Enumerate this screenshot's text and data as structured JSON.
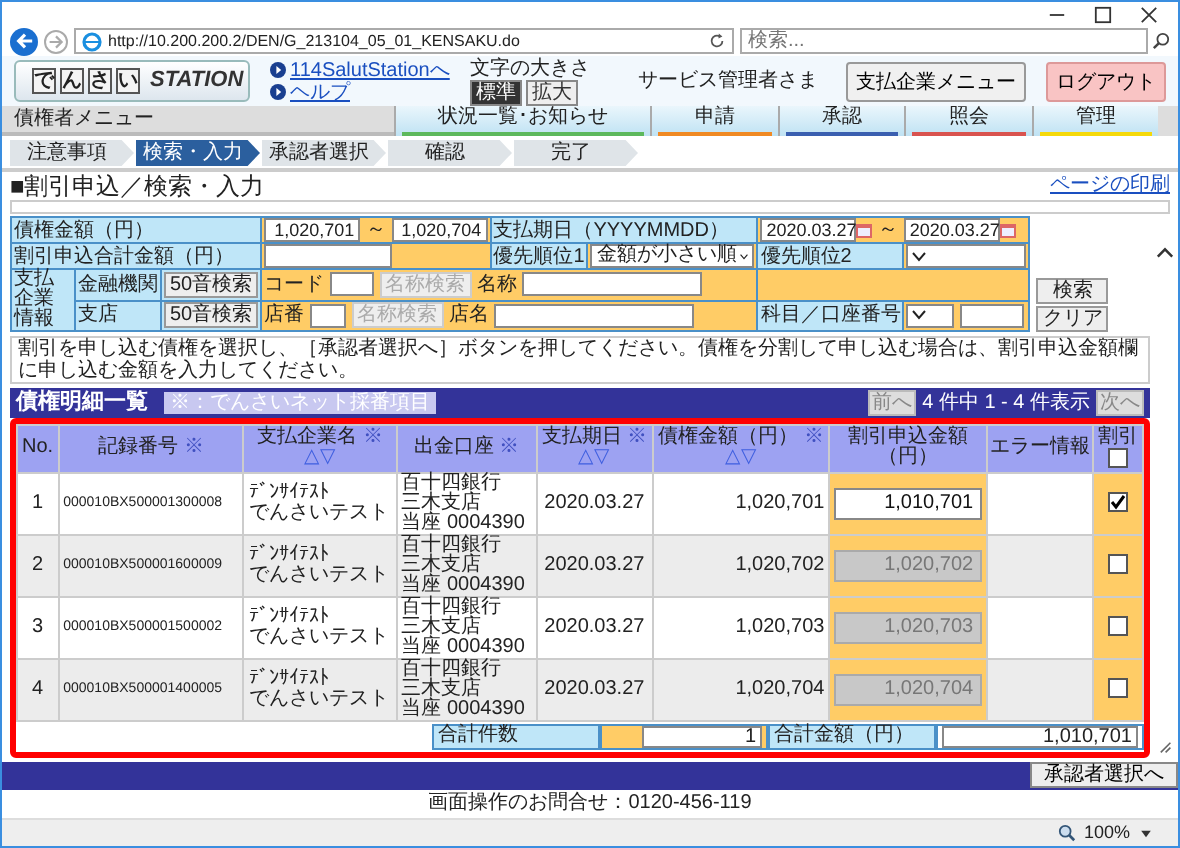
{
  "browser": {
    "url": "http://10.200.200.2/DEN/G_213104_05_01_KENSAKU.do",
    "search_placeholder": "検索..."
  },
  "header": {
    "logo": {
      "blocks": [
        "で",
        "ん",
        "さ",
        "い"
      ],
      "text": "STATION"
    },
    "links": [
      "114SalutStationへ",
      "ヘルプ"
    ],
    "font_size": {
      "label": "文字の大きさ",
      "options": [
        {
          "label": "標準",
          "selected": true
        },
        {
          "label": "拡大",
          "selected": false
        }
      ]
    },
    "user": "サービス管理者さま",
    "buttons": [
      {
        "label": "支払企業メニュー",
        "kind": "normal"
      },
      {
        "label": "ログアウト",
        "kind": "logout"
      }
    ]
  },
  "menu": {
    "title": "債権者メニュー",
    "items": [
      {
        "label": "状況一覧･お知らせ",
        "color": "#5cb85c"
      },
      {
        "label": "申請",
        "color": "#f08a24"
      },
      {
        "label": "承認",
        "color": "#3a5fb0"
      },
      {
        "label": "照会",
        "color": "#d9534f"
      },
      {
        "label": "管理",
        "color": "#f5d90a"
      }
    ]
  },
  "steps": [
    {
      "label": "注意事項",
      "selected": false
    },
    {
      "label": "検索・入力",
      "selected": true
    },
    {
      "label": "承認者選択",
      "selected": false
    },
    {
      "label": "確認",
      "selected": false
    },
    {
      "label": "完了",
      "selected": false
    }
  ],
  "page": {
    "title": "■割引申込／検索・入力",
    "print_link": "ページの印刷"
  },
  "search": {
    "amount": {
      "label": "債権金額（円）",
      "from": "1,020,701",
      "sep": "～",
      "to": "1,020,704"
    },
    "due": {
      "label": "支払期日（YYYYMMDD）",
      "from": "2020.03.27",
      "sep": "～",
      "to": "2020.03.27"
    },
    "total_label": "割引申込合計金額（円）",
    "priority1": {
      "label": "優先順位1",
      "value": "金額が小さい順"
    },
    "priority2": {
      "label": "優先順位2"
    },
    "company_label": "支払企業情報",
    "bank": {
      "label": "金融機関",
      "kana_button": "50音検索",
      "code_label": "コード",
      "name_search": {
        "label": "名称検索",
        "disabled": true
      },
      "name_label": "名称"
    },
    "branch": {
      "label": "支店",
      "kana_button": "50音検索",
      "code_label": "店番",
      "name_search": {
        "label": "名称検索",
        "disabled": true
      },
      "name_label": "店名"
    },
    "account_label": "科目／口座番号",
    "buttons": [
      "検索",
      "クリア"
    ]
  },
  "instruction": "割引を申し込む債権を選択し、［承認者選択へ］ボタンを押してください。債権を分割して申し込む場合は、割引申込金額欄に申し込む金額を入力してください。",
  "list": {
    "title": "債権明細一覧",
    "note": "※：でんさいネット採番項目",
    "pager": {
      "prev": "前へ",
      "info": "4 件中 1 - 4 件表示",
      "next": "次へ"
    },
    "columns": [
      {
        "label": "No."
      },
      {
        "label": "記録番号",
        "note": "※"
      },
      {
        "label": "支払企業名",
        "note": "※",
        "sort": "△▽"
      },
      {
        "label": "出金口座",
        "note": "※"
      },
      {
        "label": "支払期日",
        "note": "※",
        "sort": "△▽"
      },
      {
        "label": "債権金額（円）",
        "note": "※",
        "sort": "△▽"
      },
      {
        "label": "割引申込金額（円）"
      },
      {
        "label": "エラー情報"
      },
      {
        "label": "割引",
        "checked": false
      }
    ],
    "rows": [
      {
        "no": "1",
        "record": "000010BX500001300008",
        "company_kana": "ﾃﾞﾝｻｲﾃｽﾄ",
        "company": "でんさいテスト",
        "bank": "百十四銀行",
        "branch": "三木支店",
        "account": "当座 0004390",
        "due": "2020.03.27",
        "amount": "1,020,701",
        "discount": "1,010,701",
        "disabled": false,
        "checked": true
      },
      {
        "no": "2",
        "record": "000010BX500001600009",
        "company_kana": "ﾃﾞﾝｻｲﾃｽﾄ",
        "company": "でんさいテスト",
        "bank": "百十四銀行",
        "branch": "三木支店",
        "account": "当座 0004390",
        "due": "2020.03.27",
        "amount": "1,020,702",
        "discount": "1,020,702",
        "disabled": true,
        "checked": false
      },
      {
        "no": "3",
        "record": "000010BX500001500002",
        "company_kana": "ﾃﾞﾝｻｲﾃｽﾄ",
        "company": "でんさいテスト",
        "bank": "百十四銀行",
        "branch": "三木支店",
        "account": "当座 0004390",
        "due": "2020.03.27",
        "amount": "1,020,703",
        "discount": "1,020,703",
        "disabled": true,
        "checked": false
      },
      {
        "no": "4",
        "record": "000010BX500001400005",
        "company_kana": "ﾃﾞﾝｻｲﾃｽﾄ",
        "company": "でんさいテスト",
        "bank": "百十四銀行",
        "branch": "三木支店",
        "account": "当座 0004390",
        "due": "2020.03.27",
        "amount": "1,020,704",
        "discount": "1,020,704",
        "disabled": true,
        "checked": false
      }
    ],
    "totals": {
      "count_label": "合計件数",
      "count": "1",
      "amount_label": "合計金額（円）",
      "amount": "1,010,701"
    }
  },
  "footer": {
    "next_button": "承認者選択へ",
    "contact": "画面操作のお問合せ：0120-456-119"
  },
  "status_bar": {
    "zoom": "100%"
  }
}
